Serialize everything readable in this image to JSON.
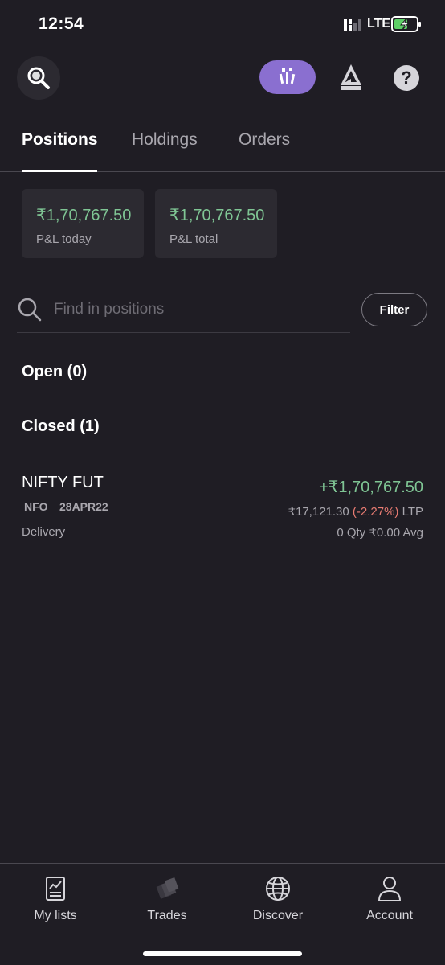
{
  "status_bar": {
    "time": "12:54",
    "network": "LTE"
  },
  "header": {
    "search_icon": "search-icon",
    "pill_icon": "kite-pill-icon",
    "logo_icon": "logo-icon",
    "help_icon": "help-icon",
    "help_glyph": "?"
  },
  "tabs": [
    {
      "label": "Positions",
      "active": true
    },
    {
      "label": "Holdings",
      "active": false
    },
    {
      "label": "Orders",
      "active": false
    }
  ],
  "summary": {
    "pl_today": {
      "value": "₹1,70,767.50",
      "label": "P&L today"
    },
    "pl_total": {
      "value": "₹1,70,767.50",
      "label": "P&L total"
    }
  },
  "search": {
    "placeholder": "Find in positions",
    "value": ""
  },
  "filter_label": "Filter",
  "sections": {
    "open": "Open (0)",
    "closed": "Closed (1)"
  },
  "positions": [
    {
      "symbol": "NIFTY FUT",
      "exchange": "NFO",
      "expiry": "28APR22",
      "product": "Delivery",
      "pnl": "+₹1,70,767.50",
      "ltp": "₹17,121.30",
      "change": "(-2.27%)",
      "ltp_label": "LTP",
      "qty": "0 Qty",
      "avg": "₹0.00 Avg"
    }
  ],
  "bottom_nav": [
    {
      "label": "My lists",
      "icon": "list-icon"
    },
    {
      "label": "Trades",
      "icon": "trades-icon"
    },
    {
      "label": "Discover",
      "icon": "globe-icon"
    },
    {
      "label": "Account",
      "icon": "user-icon"
    }
  ],
  "colors": {
    "background": "#1f1d24",
    "card": "#2c2a31",
    "profit": "#7fc594",
    "loss": "#e87b72",
    "accent": "#8a6fd0"
  }
}
